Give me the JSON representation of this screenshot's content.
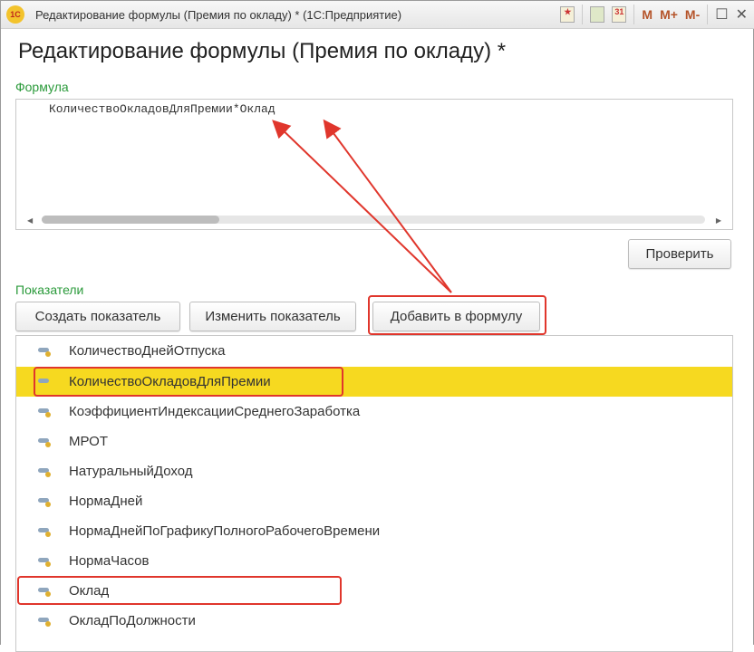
{
  "window": {
    "title": "Редактирование формулы (Премия по окладу) *  (1С:Предприятие)",
    "logo": "1С",
    "tools": [
      "favorite-icon",
      "calculator-icon",
      "calendar-icon",
      "M",
      "M+",
      "M-",
      "maximize-icon",
      "close-icon"
    ],
    "calendar_day": "31"
  },
  "heading": "Редактирование формулы (Премия по окладу) *",
  "formula": {
    "label": "Формула",
    "value": "КоличествоОкладовДляПремии*Оклад"
  },
  "check_button": "Проверить",
  "indicators": {
    "label": "Показатели",
    "create": "Создать показатель",
    "edit": "Изменить показатель",
    "add": "Добавить в формулу",
    "items": [
      "КоличествоДнейОтпуска",
      "КоличествоОкладовДляПремии",
      "КоэффициентИндексацииСреднегоЗаработка",
      "МРОТ",
      "НатуральныйДоход",
      "НормаДней",
      "НормаДнейПоГрафикуПолногоРабочегоВремени",
      "НормаЧасов",
      "Оклад",
      "ОкладПоДолжности"
    ],
    "selected_index": 1
  },
  "colors": {
    "highlight": "#f6d920",
    "annotation": "#e0362c",
    "label": "#2a9a3a"
  }
}
